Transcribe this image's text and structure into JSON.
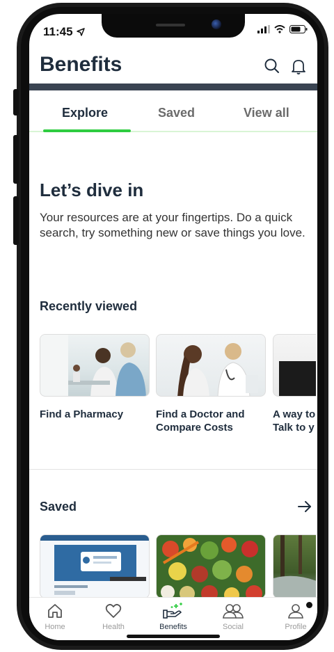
{
  "status_bar": {
    "time": "11:45",
    "icons": [
      "location-arrow-icon",
      "signal-icon",
      "wifi-icon",
      "battery-icon"
    ]
  },
  "header": {
    "title": "Benefits",
    "icons": [
      "search-icon",
      "bell-icon"
    ]
  },
  "tabs": [
    {
      "label": "Explore",
      "active": true
    },
    {
      "label": "Saved",
      "active": false
    },
    {
      "label": "View all",
      "active": false
    }
  ],
  "intro": {
    "heading": "Let’s dive in",
    "text": "Your resources are at your fingertips. Do a quick search, try something new or save things you love."
  },
  "recently_viewed": {
    "title": "Recently viewed",
    "cards": [
      {
        "label": "Find a Pharmacy"
      },
      {
        "label": "Find a Doctor and Compare Costs"
      },
      {
        "label": "A way to Talk to y"
      }
    ]
  },
  "saved": {
    "title": "Saved",
    "arrow_icon": "arrow-right-icon"
  },
  "bottom_nav": [
    {
      "label": "Home",
      "icon": "home-icon",
      "active": false
    },
    {
      "label": "Health",
      "icon": "heart-icon",
      "active": false
    },
    {
      "label": "Benefits",
      "icon": "benefits-hand-icon",
      "active": true
    },
    {
      "label": "Social",
      "icon": "people-icon",
      "active": false
    },
    {
      "label": "Profile",
      "icon": "profile-icon",
      "active": false
    }
  ],
  "colors": {
    "accent_green": "#2ecc40",
    "title_navy": "#1f2d3d",
    "header_bar": "#3a4452"
  }
}
